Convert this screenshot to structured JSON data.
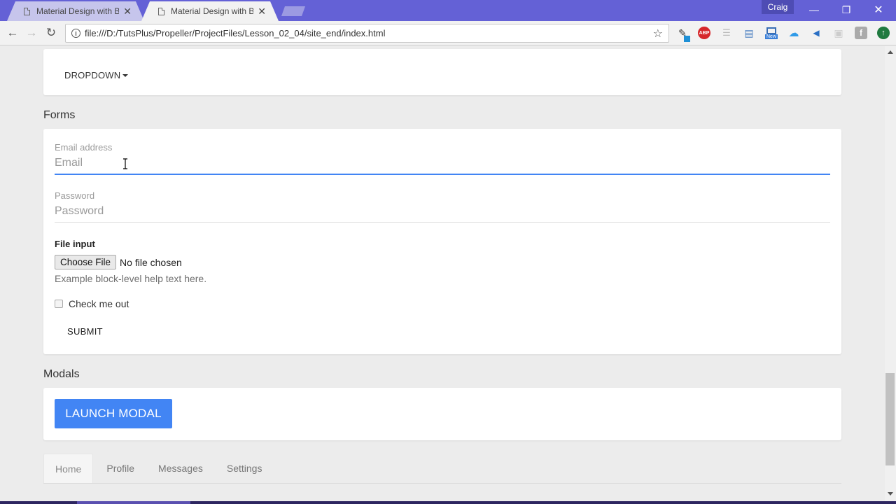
{
  "browser": {
    "tabs": [
      {
        "title": "Material Design with Boo",
        "active": false
      },
      {
        "title": "Material Design with Boo",
        "active": true
      }
    ],
    "profile_name": "Craig",
    "url": "file:///D:/TutsPlus/Propeller/ProjectFiles/Lesson_02_04/site_end/index.html",
    "window_controls": {
      "minimize": "—",
      "restore": "❐",
      "close": "✕"
    },
    "nav": {
      "back": "←",
      "forward": "→",
      "reload": "↻"
    },
    "extensions": [
      {
        "name": "eyedropper-icon",
        "glyph": "✎"
      },
      {
        "name": "adblock-plus-icon",
        "glyph": "ABP"
      },
      {
        "name": "reader-icon",
        "glyph": "☰"
      },
      {
        "name": "screenshot-folder-icon",
        "glyph": "▤"
      },
      {
        "name": "snagit-new-icon",
        "glyph": "New"
      },
      {
        "name": "cloud-icon",
        "glyph": "☁"
      },
      {
        "name": "send-tab-icon",
        "glyph": "◀"
      },
      {
        "name": "camera-icon",
        "glyph": "▣"
      },
      {
        "name": "font-icon",
        "glyph": "f"
      },
      {
        "name": "upload-arrow-icon",
        "glyph": "↑"
      }
    ]
  },
  "page": {
    "dropdown": {
      "label": "DROPDOWN"
    },
    "forms": {
      "section_title": "Forms",
      "email": {
        "label": "Email address",
        "placeholder": "Email",
        "value": ""
      },
      "password": {
        "label": "Password",
        "placeholder": "Password",
        "value": ""
      },
      "file_input": {
        "label": "File input",
        "button": "Choose File",
        "status": "No file chosen",
        "help": "Example block-level help text here."
      },
      "checkbox": {
        "label": "Check me out",
        "checked": false
      },
      "submit": "SUBMIT"
    },
    "modals": {
      "section_title": "Modals",
      "launch_button": "LAUNCH MODAL"
    },
    "nav_tabs": [
      {
        "label": "Home",
        "active": true
      },
      {
        "label": "Profile",
        "active": false
      },
      {
        "label": "Messages",
        "active": false
      },
      {
        "label": "Settings",
        "active": false
      }
    ]
  },
  "colors": {
    "titlebar": "#6461d6",
    "primary": "#4285f4",
    "page_bg": "#ececec"
  }
}
